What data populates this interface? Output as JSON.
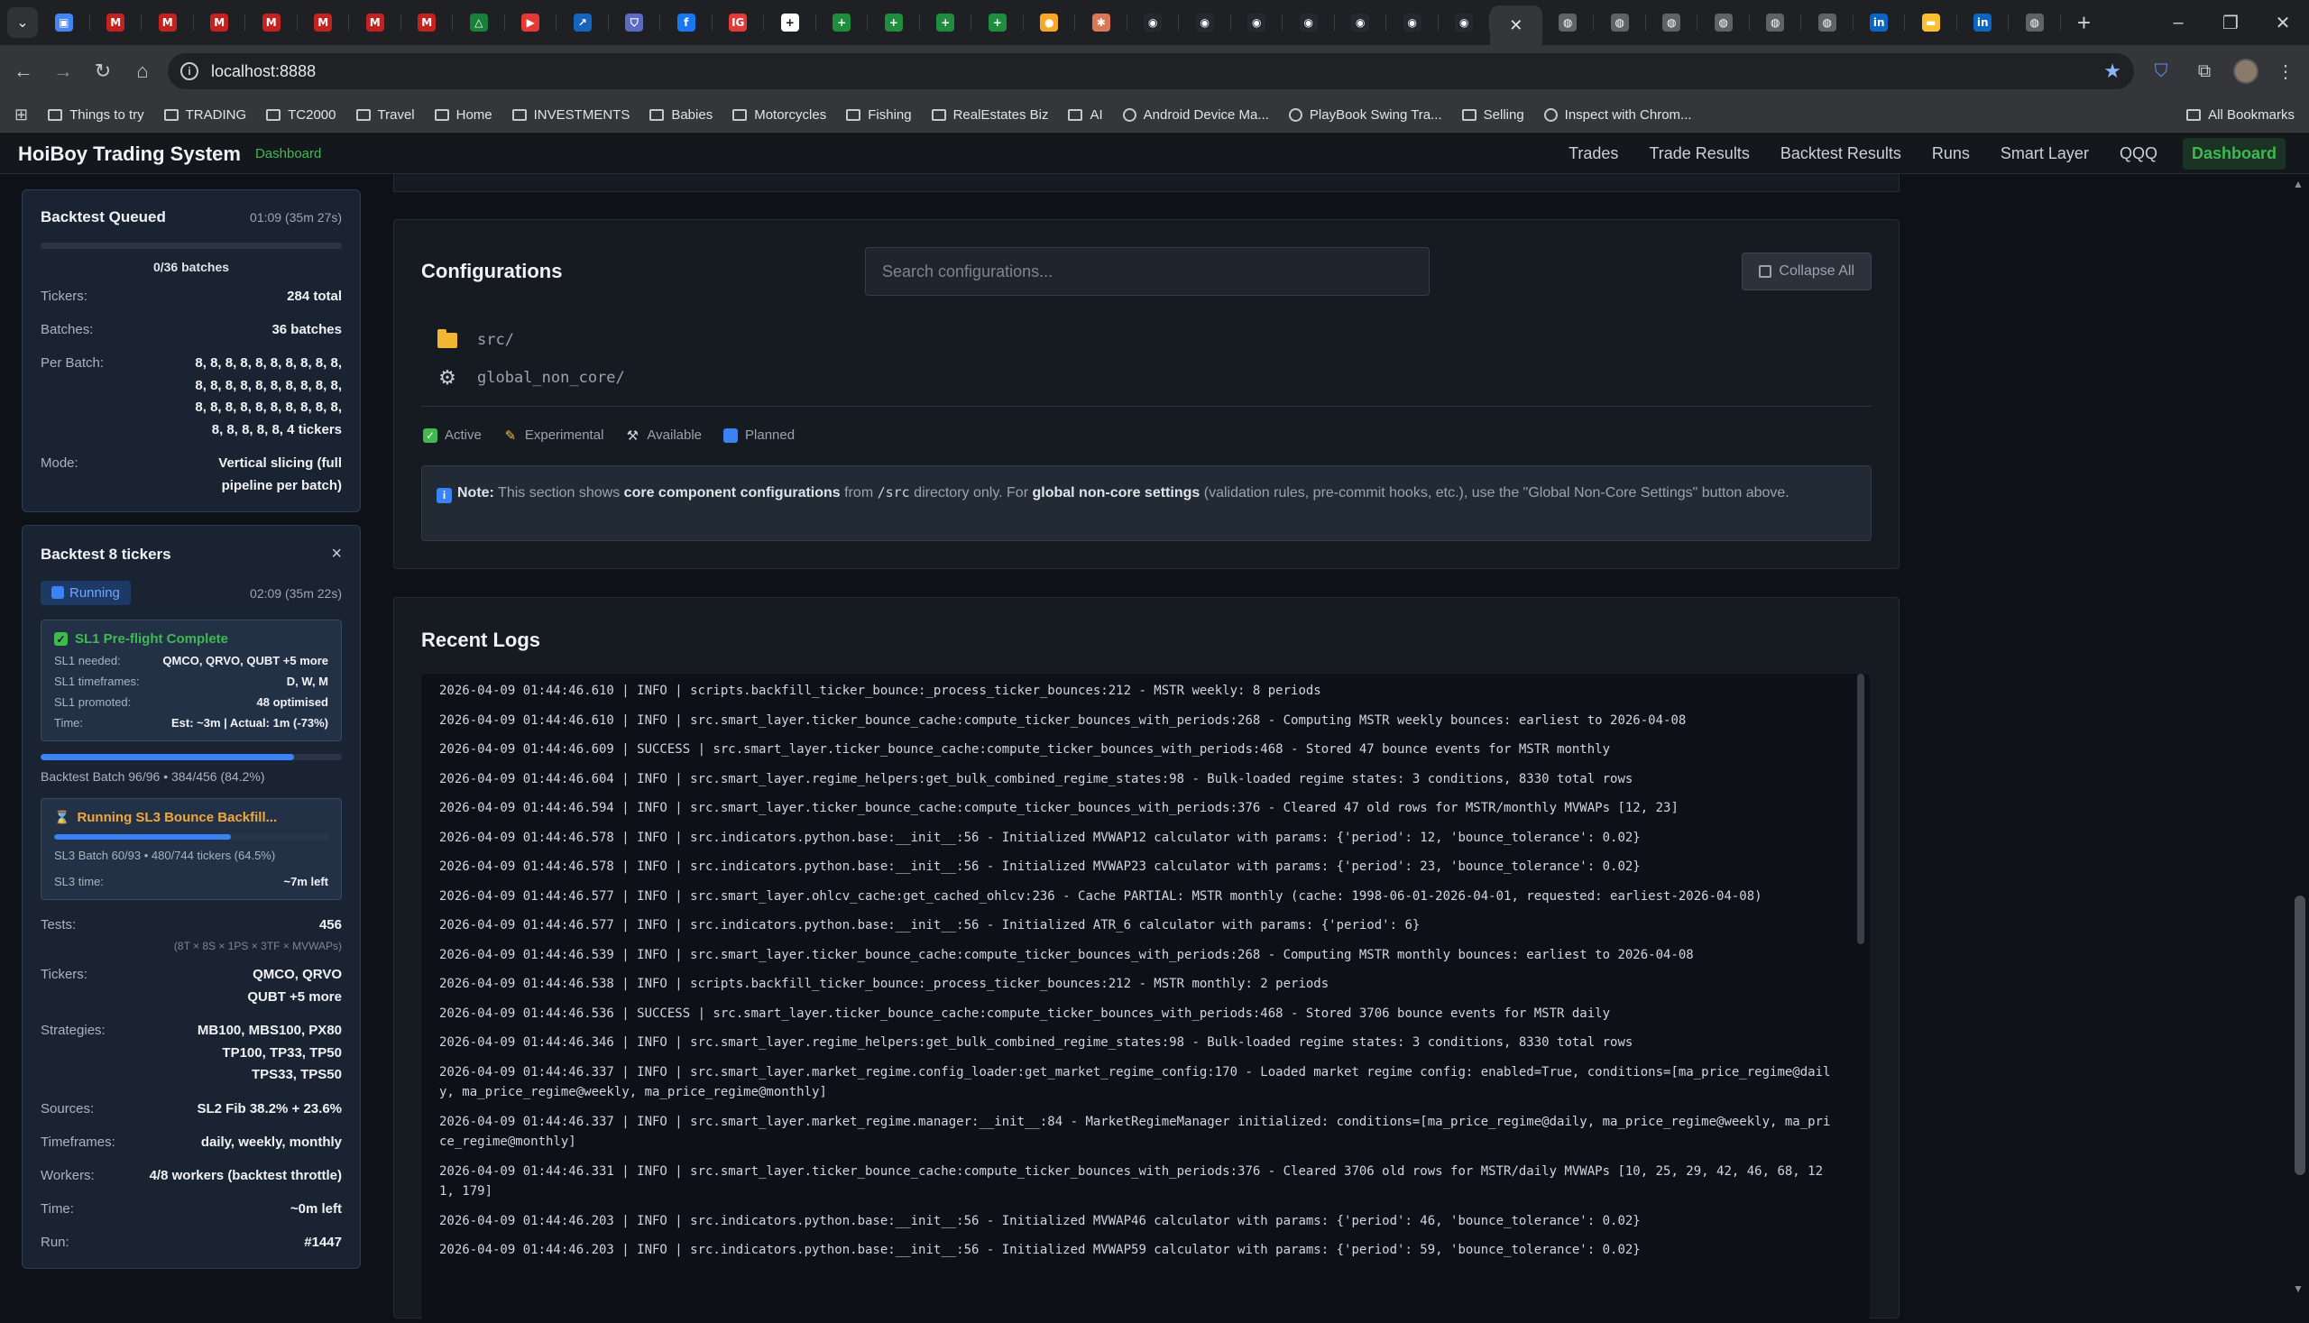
{
  "browser": {
    "tab_icons": [
      "drive-icon",
      "gmail-icon",
      "gmail-icon",
      "gmail-icon",
      "gmail-icon",
      "gmail-icon",
      "gmail-icon",
      "gmail-icon",
      "google-drive-icon",
      "youtube-icon",
      "chart-icon",
      "shield-icon",
      "facebook-icon",
      "ig-icon",
      "plus-icon",
      "sheets-icon",
      "sheets-icon",
      "sheets-icon",
      "sheets-icon",
      "coin-icon",
      "claude-icon",
      "github-icon",
      "github-icon",
      "github-icon",
      "github-icon",
      "github-icon",
      "github-icon",
      "github-icon",
      "close-icon",
      "globe-icon",
      "globe-icon",
      "globe-icon",
      "globe-icon",
      "globe-icon",
      "globe-icon",
      "linkedin-icon",
      "flag-icon",
      "linkedin-icon",
      "globe-icon"
    ],
    "url": "localhost:8888",
    "bookmarks": [
      "Things to try",
      "TRADING",
      "TC2000",
      "Travel",
      "Home",
      "INVESTMENTS",
      "Babies",
      "Motorcycles",
      "Fishing",
      "RealEstates Biz",
      "AI",
      "Android Device Ma...",
      "PlayBook Swing Tra...",
      "Selling",
      "Inspect with Chrom..."
    ],
    "all_bookmarks": "All Bookmarks"
  },
  "nav": {
    "brand": "HoiBoy Trading System",
    "subtitle": "Dashboard",
    "links": [
      "Trades",
      "Trade Results",
      "Backtest Results",
      "Runs",
      "Smart Layer",
      "QQQ"
    ],
    "active": "Dashboard"
  },
  "queued": {
    "title": "Backtest Queued",
    "time": "01:09 (35m 27s)",
    "progress": 0,
    "batches_caption": "0/36 batches",
    "tickers_label": "Tickers:",
    "tickers_value": "284 total",
    "batches_label": "Batches:",
    "batches_value": "36 batches",
    "per_batch_label": "Per Batch:",
    "per_batch_value": "8, 8, 8, 8, 8, 8, 8, 8, 8, 8, 8, 8, 8, 8, 8, 8, 8, 8, 8, 8, 8, 8, 8, 8, 8, 8, 8, 8, 8, 8, 8, 8, 8, 8, 8, 4 tickers",
    "mode_label": "Mode:",
    "mode_value": "Vertical slicing (full pipeline per batch)"
  },
  "running": {
    "title": "Backtest 8 tickers",
    "close": "×",
    "status": "Running",
    "time": "02:09 (35m 22s)",
    "sl1": {
      "title": "SL1 Pre-flight Complete",
      "needed_label": "SL1 needed:",
      "needed_value": "QMCO, QRVO, QUBT +5 more",
      "timeframes_label": "SL1 timeframes:",
      "timeframes_value": "D, W, M",
      "promoted_label": "SL1 promoted:",
      "promoted_value": "48 optimised",
      "time_label": "Time:",
      "time_value": "Est: ~3m | Actual: 1m (-73%)"
    },
    "batch_progress": 0.842,
    "batch_caption": "Backtest Batch 96/96 • 384/456 (84.2%)",
    "sl3": {
      "title": "Running SL3 Bounce Backfill...",
      "progress": 0.645,
      "caption": "SL3 Batch 60/93 • 480/744 tickers (64.5%)",
      "time_label": "SL3 time:",
      "time_value": "~7m left"
    },
    "tests_label": "Tests:",
    "tests_value": "456",
    "tests_note": "(8T × 8S × 1PS × 3TF × MVWAPs)",
    "tickers_label": "Tickers:",
    "tickers_value": "QMCO, QRVO QUBT +5 more",
    "strategies_label": "Strategies:",
    "strategies_value": "MB100, MBS100, PX80 TP100, TP33, TP50 TPS33, TPS50",
    "sources_label": "Sources:",
    "sources_value": "SL2 Fib 38.2% + 23.6%",
    "timeframes_label": "Timeframes:",
    "timeframes_value": "daily, weekly, monthly",
    "workers_label": "Workers:",
    "workers_value": "4/8 workers (backtest throttle)",
    "time_label": "Time:",
    "time_value": "~0m left",
    "run_label": "Run:",
    "run_value": "#1447"
  },
  "config": {
    "title": "Configurations",
    "search_placeholder": "Search configurations...",
    "collapse_label": "Collapse All",
    "tree": [
      "src/",
      "global_non_core/"
    ],
    "legend": [
      "Active",
      "Experimental",
      "Available",
      "Planned"
    ],
    "note_label": "Note:",
    "note_1": "This section shows",
    "note_2": "core component configurations",
    "note_3": "from",
    "note_4": "/src",
    "note_5": "directory only. For",
    "note_6": "global non-core settings",
    "note_7": "(validation rules, pre-commit hooks, etc.), use the \"Global Non-Core Settings\" button above."
  },
  "logs": {
    "title": "Recent Logs",
    "lines": [
      "2026-04-09 01:44:46.610 | INFO | scripts.backfill_ticker_bounce:_process_ticker_bounces:212 - MSTR weekly: 8 periods",
      "2026-04-09 01:44:46.610 | INFO | src.smart_layer.ticker_bounce_cache:compute_ticker_bounces_with_periods:268 - Computing MSTR weekly bounces: earliest to 2026-04-08",
      "2026-04-09 01:44:46.609 | SUCCESS | src.smart_layer.ticker_bounce_cache:compute_ticker_bounces_with_periods:468 - Stored 47 bounce events for MSTR monthly",
      "2026-04-09 01:44:46.604 | INFO | src.smart_layer.regime_helpers:get_bulk_combined_regime_states:98 - Bulk-loaded regime states: 3 conditions, 8330 total rows",
      "2026-04-09 01:44:46.594 | INFO | src.smart_layer.ticker_bounce_cache:compute_ticker_bounces_with_periods:376 - Cleared 47 old rows for MSTR/monthly MVWAPs [12, 23]",
      "2026-04-09 01:44:46.578 | INFO | src.indicators.python.base:__init__:56 - Initialized MVWAP12 calculator with params: {'period': 12, 'bounce_tolerance': 0.02}",
      "2026-04-09 01:44:46.578 | INFO | src.indicators.python.base:__init__:56 - Initialized MVWAP23 calculator with params: {'period': 23, 'bounce_tolerance': 0.02}",
      "2026-04-09 01:44:46.577 | INFO | src.smart_layer.ohlcv_cache:get_cached_ohlcv:236 - Cache PARTIAL: MSTR monthly (cache: 1998-06-01-2026-04-01, requested: earliest-2026-04-08)",
      "2026-04-09 01:44:46.577 | INFO | src.indicators.python.base:__init__:56 - Initialized ATR_6 calculator with params: {'period': 6}",
      "2026-04-09 01:44:46.539 | INFO | src.smart_layer.ticker_bounce_cache:compute_ticker_bounces_with_periods:268 - Computing MSTR monthly bounces: earliest to 2026-04-08",
      "2026-04-09 01:44:46.538 | INFO | scripts.backfill_ticker_bounce:_process_ticker_bounces:212 - MSTR monthly: 2 periods",
      "2026-04-09 01:44:46.536 | SUCCESS | src.smart_layer.ticker_bounce_cache:compute_ticker_bounces_with_periods:468 - Stored 3706 bounce events for MSTR daily",
      "2026-04-09 01:44:46.346 | INFO | src.smart_layer.regime_helpers:get_bulk_combined_regime_states:98 - Bulk-loaded regime states: 3 conditions, 8330 total rows",
      "2026-04-09 01:44:46.337 | INFO | src.smart_layer.market_regime.config_loader:get_market_regime_config:170 - Loaded market regime config: enabled=True, conditions=[ma_price_regime@daily, ma_price_regime@weekly, ma_price_regime@monthly]",
      "2026-04-09 01:44:46.337 | INFO | src.smart_layer.market_regime.manager:__init__:84 - MarketRegimeManager initialized: conditions=[ma_price_regime@daily, ma_price_regime@weekly, ma_price_regime@monthly]",
      "2026-04-09 01:44:46.331 | INFO | src.smart_layer.ticker_bounce_cache:compute_ticker_bounces_with_periods:376 - Cleared 3706 old rows for MSTR/daily MVWAPs [10, 25, 29, 42, 46, 68, 121, 179]",
      "2026-04-09 01:44:46.203 | INFO | src.indicators.python.base:__init__:56 - Initialized MVWAP46 calculator with params: {'period': 46, 'bounce_tolerance': 0.02}",
      "2026-04-09 01:44:46.203 | INFO | src.indicators.python.base:__init__:56 - Initialized MVWAP59 calculator with params: {'period': 59, 'bounce_tolerance': 0.02}"
    ]
  },
  "colors": {
    "accent_green": "#3fb950",
    "accent_blue": "#3b82f6",
    "accent_orange": "#f0a83a",
    "background": "#0e1116"
  }
}
